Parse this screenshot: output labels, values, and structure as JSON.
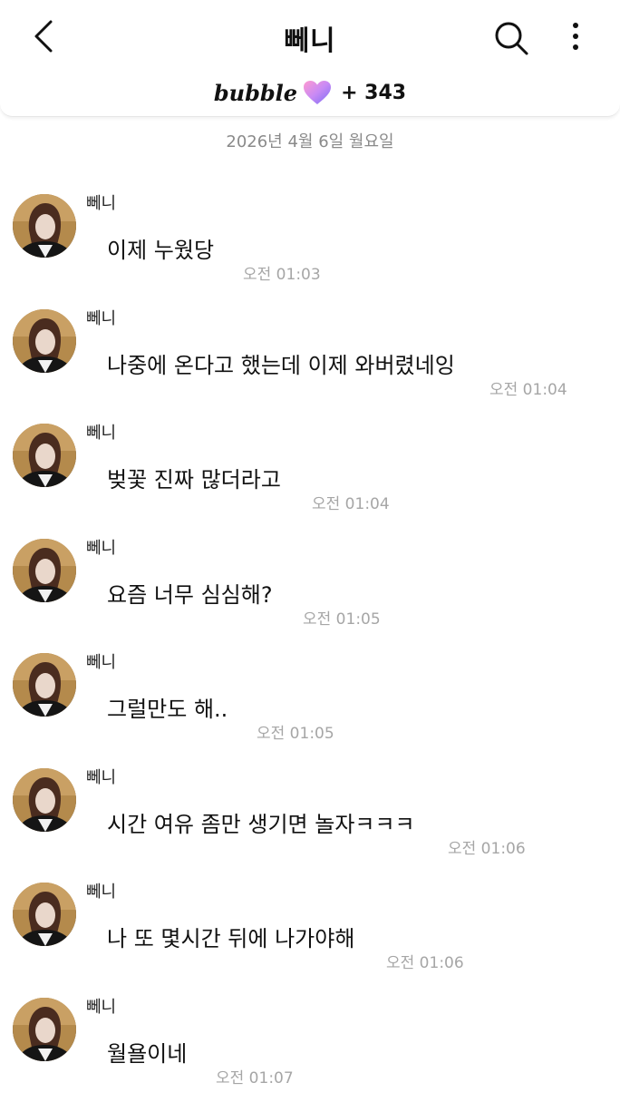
{
  "header": {
    "title": "뻬니",
    "bubble_logo": "bubble",
    "bubble_count": "+ 343",
    "accent_color": "#8f6cf0"
  },
  "date_divider": "2026년 4월 6일 월요일",
  "messages": [
    {
      "sender": "뻬니",
      "text": "이제 누웠당",
      "time": "오전 01:03"
    },
    {
      "sender": "뻬니",
      "text": "나중에 온다고 했는데 이제 와버렸네잉",
      "time": "오전 01:04"
    },
    {
      "sender": "뻬니",
      "text": "벚꽃 진짜 많더라고",
      "time": "오전 01:04"
    },
    {
      "sender": "뻬니",
      "text": "요즘 너무 심심해?",
      "time": "오전 01:05"
    },
    {
      "sender": "뻬니",
      "text": "그럴만도 해..",
      "time": "오전 01:05"
    },
    {
      "sender": "뻬니",
      "text": "시간 여유 좀만 생기면 놀자ㅋㅋㅋ",
      "time": "오전 01:06"
    },
    {
      "sender": "뻬니",
      "text": "나 또 몇시간 뒤에 나가야해",
      "time": "오전 01:06"
    },
    {
      "sender": "뻬니",
      "text": "월욜이네",
      "time": "오전 01:07"
    }
  ]
}
